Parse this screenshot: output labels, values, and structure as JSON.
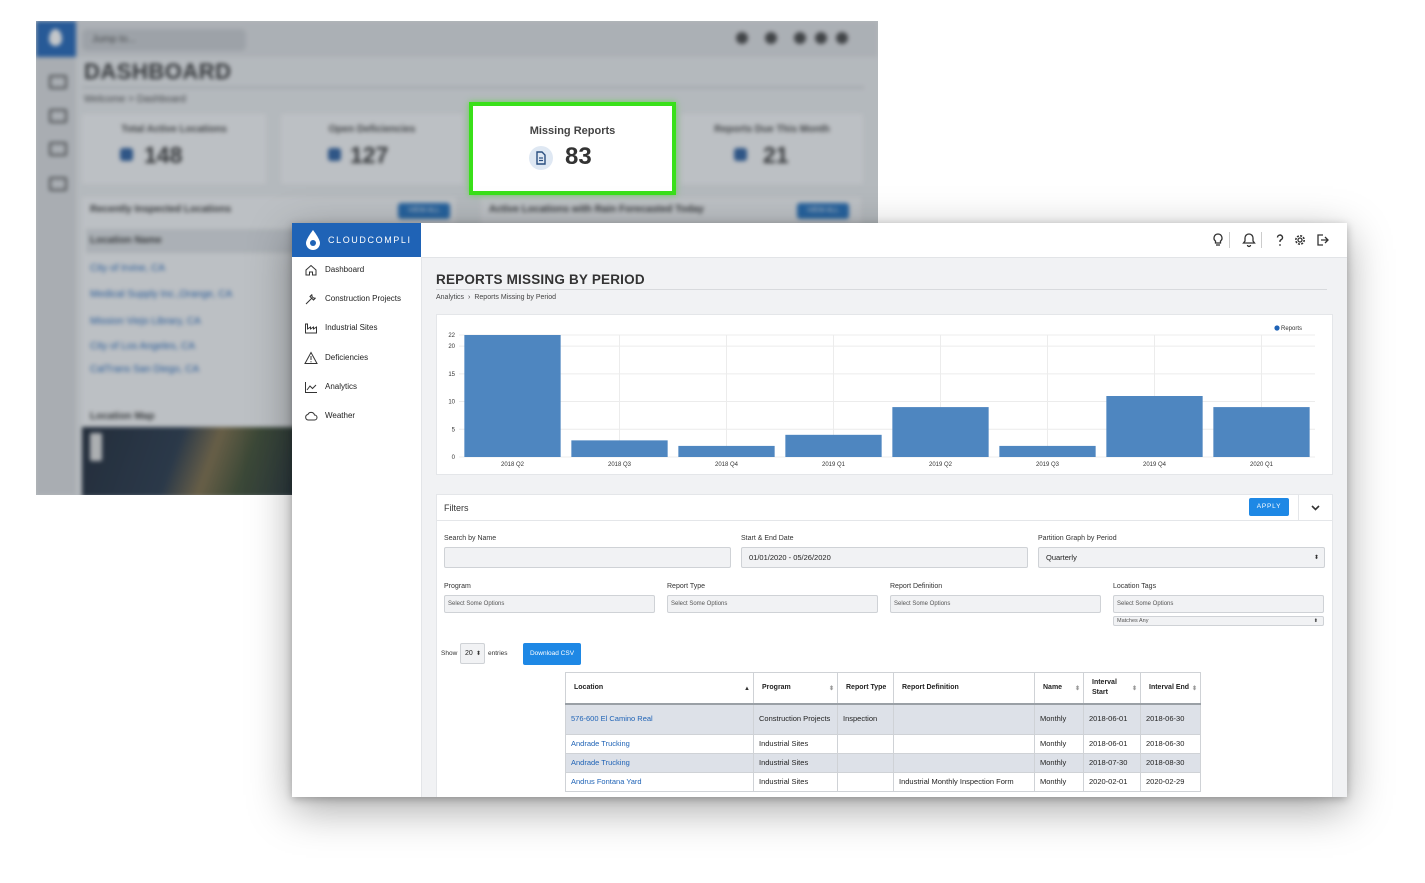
{
  "background_dashboard": {
    "search_placeholder": "Jump to...",
    "title": "DASHBOARD",
    "breadcrumb": "Welcome  >  Dashboard",
    "cards": [
      {
        "label": "Total Active Locations",
        "value": "148"
      },
      {
        "label": "Open Deficiencies",
        "value": "127"
      },
      {
        "label": "Missing Reports",
        "value": "83"
      },
      {
        "label": "Reports Due This Month",
        "value": "21"
      }
    ],
    "panels": [
      {
        "title": "Recently Inspected Locations",
        "button": "VIEW ALL"
      },
      {
        "title": "Active Locations with Rain Forecasted Today",
        "button": "VIEW ALL"
      }
    ],
    "column_header": "Location Name",
    "locations": [
      "City of Irvine, CA",
      "Medical Supply Inc.,Orange, CA",
      "Mission Viejo Library, CA",
      "City of Los Angeles, CA",
      "CalTrans San Diego, CA"
    ],
    "map_title": "Location Map",
    "highlight_color": "#39e019"
  },
  "app": {
    "brand": "CLOUDCOMPLI",
    "brand_color": "#1f63b6",
    "top_icons": [
      "lightbulb-icon",
      "bell-icon",
      "help-icon",
      "gear-icon",
      "logout-icon"
    ]
  },
  "sidebar": {
    "items": [
      {
        "label": "Dashboard",
        "icon": "home-icon"
      },
      {
        "label": "Construction Projects",
        "icon": "wrench-icon"
      },
      {
        "label": "Industrial Sites",
        "icon": "factory-icon"
      },
      {
        "label": "Deficiencies",
        "icon": "warning-icon"
      },
      {
        "label": "Analytics",
        "icon": "chart-icon"
      },
      {
        "label": "Weather",
        "icon": "cloud-icon"
      }
    ]
  },
  "page": {
    "title": "REPORTS MISSING BY PERIOD",
    "breadcrumb": [
      "Analytics",
      "Reports Missing by Period"
    ],
    "breadcrumb_sep": "›"
  },
  "chart_data": {
    "type": "bar",
    "categories": [
      "2018 Q2",
      "2018 Q3",
      "2018 Q4",
      "2019 Q1",
      "2019 Q2",
      "2019 Q3",
      "2019 Q4",
      "2020 Q1"
    ],
    "series": [
      {
        "name": "Reports",
        "values": [
          22,
          3,
          2,
          4,
          9,
          2,
          11,
          9
        ]
      }
    ],
    "yticks": [
      0,
      5,
      10,
      15,
      20,
      22
    ],
    "ylim": [
      0,
      22
    ],
    "grid": true,
    "legend": "top-right",
    "bar_color": "#4e86c0"
  },
  "filters": {
    "title": "Filters",
    "apply_label": "APPLY",
    "search_label": "Search by Name",
    "search_value": "",
    "date_label": "Start & End Date",
    "date_value": "01/01/2020 - 05/26/2020",
    "partition_label": "Partition Graph by Period",
    "partition_value": "Quarterly",
    "program_label": "Program",
    "report_type_label": "Report Type",
    "report_definition_label": "Report Definition",
    "location_tags_label": "Location Tags",
    "select_placeholder": "Select Some Options",
    "matches_value": "Matches Any",
    "accent_color": "#1e88e5"
  },
  "table_controls": {
    "show_label": "Show",
    "entries_value": "20",
    "entries_label": "entries",
    "download_label": "Download CSV"
  },
  "table": {
    "headers": [
      "Location",
      "Program",
      "Report Type",
      "Report Definition",
      "Name",
      "Interval Start",
      "Interval End"
    ],
    "rows": [
      {
        "location": "576-600 El Camino Real",
        "program": "Construction Projects",
        "report_type": "Inspection",
        "report_definition": "",
        "name": "Monthly",
        "start": "2018-06-01",
        "end": "2018-06-30"
      },
      {
        "location": "Andrade Trucking",
        "program": "Industrial Sites",
        "report_type": "",
        "report_definition": "",
        "name": "Monthly",
        "start": "2018-06-01",
        "end": "2018-06-30"
      },
      {
        "location": "Andrade Trucking",
        "program": "Industrial Sites",
        "report_type": "",
        "report_definition": "",
        "name": "Monthly",
        "start": "2018-07-30",
        "end": "2018-08-30"
      },
      {
        "location": "Andrus Fontana Yard",
        "program": "Industrial Sites",
        "report_type": "",
        "report_definition": "Industrial Monthly Inspection Form",
        "name": "Monthly",
        "start": "2020-02-01",
        "end": "2020-02-29"
      }
    ]
  }
}
